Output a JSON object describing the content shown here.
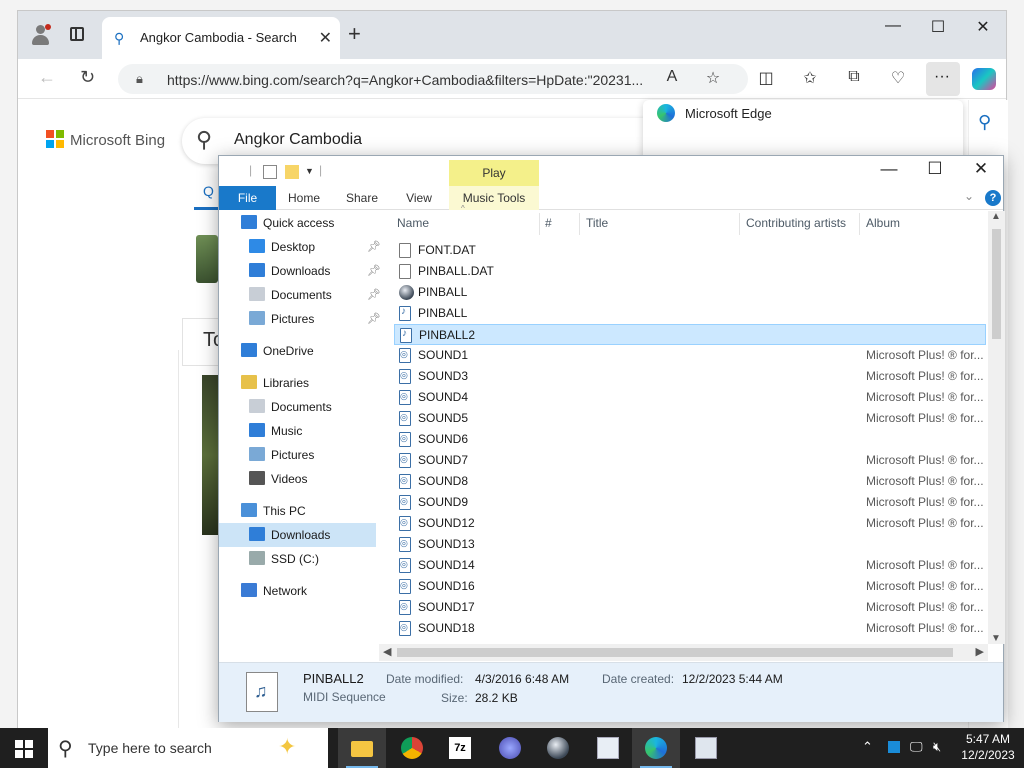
{
  "browser": {
    "tab_title": "Angkor Cambodia - Search",
    "url": "https://www.bing.com/search?q=Angkor+Cambodia&filters=HpDate:\"20231...",
    "popup_title": "Microsoft Edge"
  },
  "bing": {
    "brand": "Microsoft Bing",
    "query": "Angkor Cambodia",
    "card_text": "To"
  },
  "explorer": {
    "play_tab": "Play",
    "ribbon_tabs": [
      "File",
      "Home",
      "Share",
      "View",
      "Music Tools"
    ],
    "nav": [
      {
        "label": "Quick access",
        "icon": "star-icon"
      },
      {
        "label": "Desktop",
        "icon": "desktop-icon",
        "pinned": true
      },
      {
        "label": "Downloads",
        "icon": "download-icon",
        "pinned": true
      },
      {
        "label": "Documents",
        "icon": "documents-icon",
        "pinned": true
      },
      {
        "label": "Pictures",
        "icon": "pictures-icon",
        "pinned": true
      },
      {
        "label": "OneDrive",
        "icon": "cloud-icon"
      },
      {
        "label": "Libraries",
        "icon": "libraries-icon"
      },
      {
        "label": "Documents",
        "icon": "documents-icon"
      },
      {
        "label": "Music",
        "icon": "music-icon"
      },
      {
        "label": "Pictures",
        "icon": "pictures-icon"
      },
      {
        "label": "Videos",
        "icon": "videos-icon"
      },
      {
        "label": "This PC",
        "icon": "pc-icon"
      },
      {
        "label": "Downloads",
        "icon": "download-icon",
        "selected": true
      },
      {
        "label": "SSD (C:)",
        "icon": "drive-icon"
      },
      {
        "label": "Network",
        "icon": "network-icon"
      }
    ],
    "columns": [
      "Name",
      "#",
      "Title",
      "Contributing artists",
      "Album"
    ],
    "files": [
      {
        "name": "FONT.DAT",
        "type": "file",
        "artist": ""
      },
      {
        "name": "PINBALL.DAT",
        "type": "file",
        "artist": ""
      },
      {
        "name": "PINBALL",
        "type": "exe",
        "artist": ""
      },
      {
        "name": "PINBALL",
        "type": "midi",
        "artist": ""
      },
      {
        "name": "PINBALL2",
        "type": "midi",
        "artist": "",
        "selected": true
      },
      {
        "name": "SOUND1",
        "type": "mid",
        "artist": "Microsoft Plus! ® for..."
      },
      {
        "name": "SOUND3",
        "type": "mid",
        "artist": "Microsoft Plus! ® for..."
      },
      {
        "name": "SOUND4",
        "type": "mid",
        "artist": "Microsoft Plus! ® for..."
      },
      {
        "name": "SOUND5",
        "type": "mid",
        "artist": "Microsoft Plus! ® for..."
      },
      {
        "name": "SOUND6",
        "type": "mid",
        "artist": ""
      },
      {
        "name": "SOUND7",
        "type": "mid",
        "artist": "Microsoft Plus! ® for..."
      },
      {
        "name": "SOUND8",
        "type": "mid",
        "artist": "Microsoft Plus! ® for..."
      },
      {
        "name": "SOUND9",
        "type": "mid",
        "artist": "Microsoft Plus! ® for..."
      },
      {
        "name": "SOUND12",
        "type": "mid",
        "artist": "Microsoft Plus! ® for..."
      },
      {
        "name": "SOUND13",
        "type": "mid",
        "artist": ""
      },
      {
        "name": "SOUND14",
        "type": "mid",
        "artist": "Microsoft Plus! ® for..."
      },
      {
        "name": "SOUND16",
        "type": "mid",
        "artist": "Microsoft Plus! ® for..."
      },
      {
        "name": "SOUND17",
        "type": "mid",
        "artist": "Microsoft Plus! ® for..."
      },
      {
        "name": "SOUND18",
        "type": "mid",
        "artist": "Microsoft Plus! ® for..."
      }
    ],
    "details": {
      "name": "PINBALL2",
      "type": "MIDI Sequence",
      "modified_label": "Date modified:",
      "modified": "4/3/2016 6:48 AM",
      "size_label": "Size:",
      "size": "28.2 KB",
      "created_label": "Date created:",
      "created": "12/2/2023 5:44 AM"
    }
  },
  "taskbar": {
    "search_placeholder": "Type here to search",
    "time": "5:47 AM",
    "date": "12/2/2023"
  },
  "colors": {
    "accent": "#1979ca",
    "selection": "#cce8ff",
    "music_tools": "#f4f08a"
  }
}
